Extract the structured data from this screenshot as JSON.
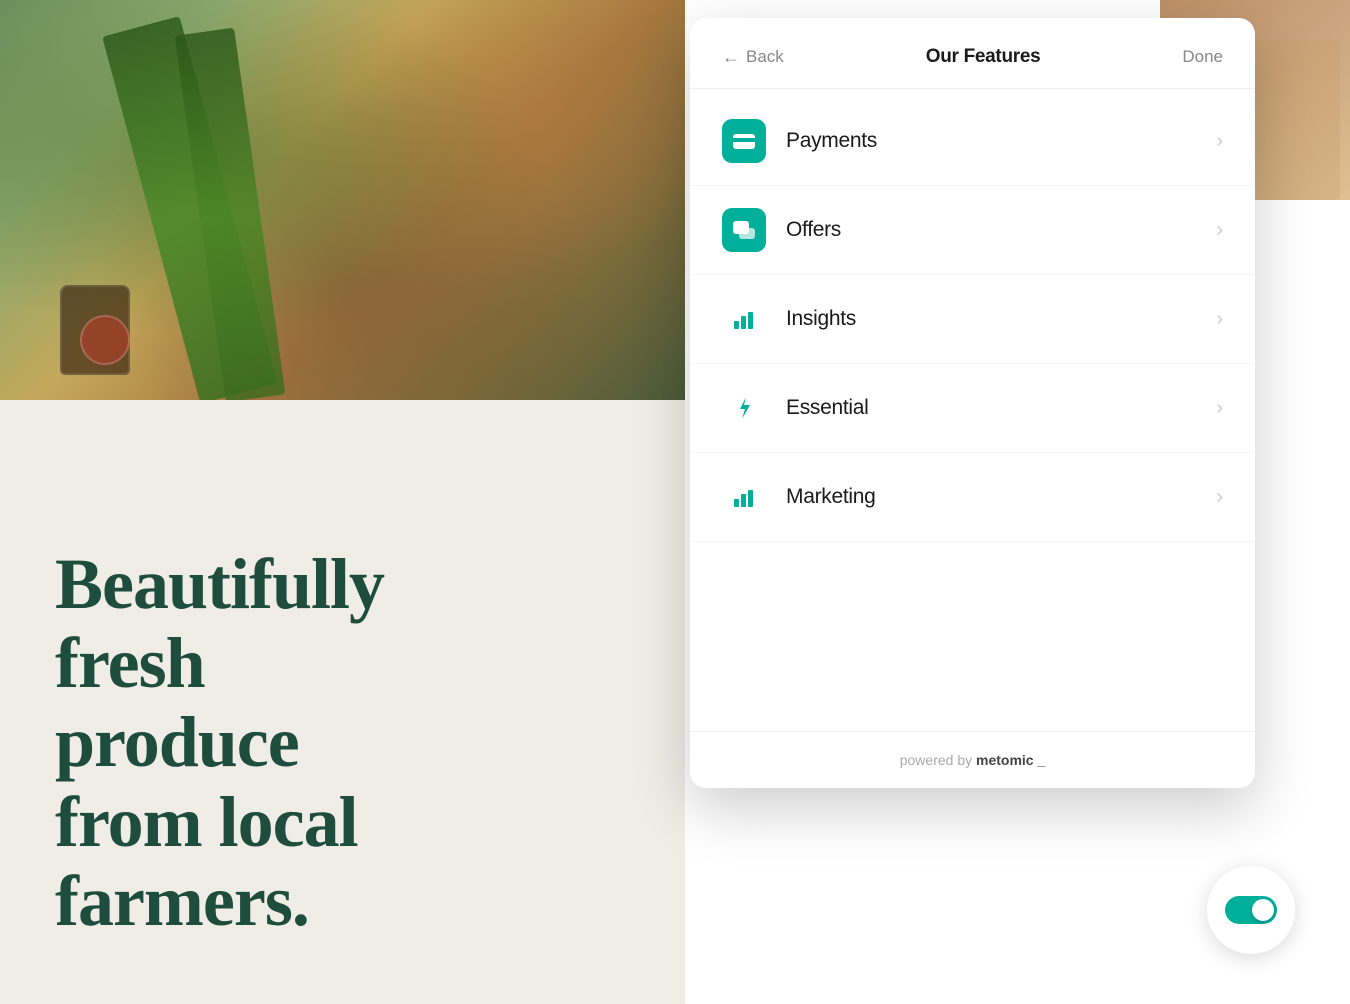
{
  "panel": {
    "title": "Our Features",
    "back_label": "Back",
    "done_label": "Done",
    "footer_text": "powered by",
    "footer_brand": "metomic _",
    "features": [
      {
        "id": "payments",
        "label": "Payments",
        "icon_type": "card",
        "icon_color": "#00b09b"
      },
      {
        "id": "offers",
        "label": "Offers",
        "icon_type": "chat",
        "icon_color": "#00b09b"
      },
      {
        "id": "insights",
        "label": "Insights",
        "icon_type": "bar-chart",
        "icon_color": "#00b09b"
      },
      {
        "id": "essential",
        "label": "Essential",
        "icon_type": "lightning",
        "icon_color": "#00b09b"
      },
      {
        "id": "marketing",
        "label": "Marketing",
        "icon_type": "bar-chart",
        "icon_color": "#00b09b"
      }
    ]
  },
  "hero": {
    "line1": "Beautifully",
    "line2": "fresh",
    "line3": "produce",
    "line4": "from local",
    "line5": "farmers."
  },
  "toggle": {
    "label": "cookie-toggle",
    "active": true
  }
}
